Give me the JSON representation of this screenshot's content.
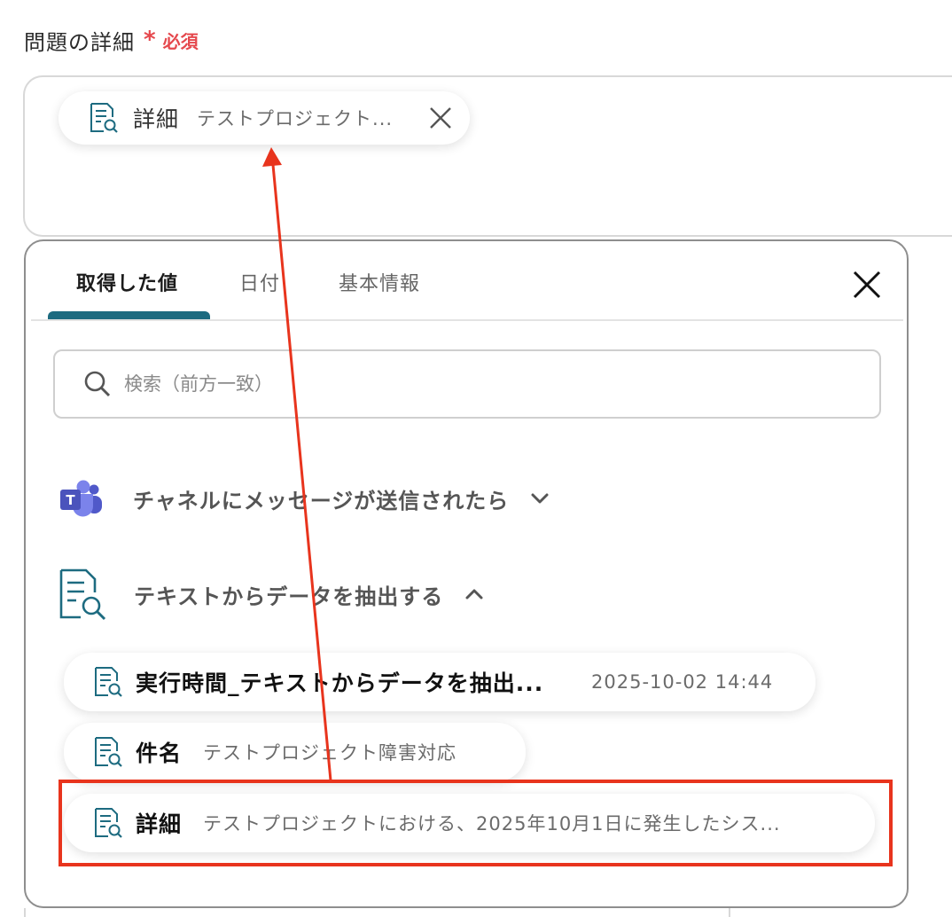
{
  "field": {
    "label": "問題の詳細",
    "required_mark": "*",
    "required_text": "必須"
  },
  "selected_chip": {
    "icon": "document-search-icon",
    "name": "詳細",
    "value": "テストプロジェクト..."
  },
  "tabs": [
    {
      "label": "取得した値",
      "active": true
    },
    {
      "label": "日付",
      "active": false
    },
    {
      "label": "基本情報",
      "active": false
    }
  ],
  "search": {
    "placeholder": "検索（前方一致）",
    "value": ""
  },
  "sections": [
    {
      "icon": "microsoft-teams-icon",
      "label": "チャネルにメッセージが送信されたら",
      "expanded": false
    },
    {
      "icon": "document-search-icon",
      "label": "テキストからデータを抽出する",
      "expanded": true
    }
  ],
  "items": [
    {
      "icon": "document-search-icon",
      "name": "実行時間_テキストからデータを抽出...",
      "value": "2025-10-02 14:44"
    },
    {
      "icon": "document-search-icon",
      "name": "件名",
      "value": "テストプロジェクト障害対応"
    },
    {
      "icon": "document-search-icon",
      "name": "詳細",
      "value": "テストプロジェクトにおける、2025年10月1日に発生したシス..."
    }
  ],
  "colors": {
    "accent": "#1d6b80",
    "required": "#e5484d",
    "highlight": "#e8341d",
    "teams": "#5059c9"
  }
}
